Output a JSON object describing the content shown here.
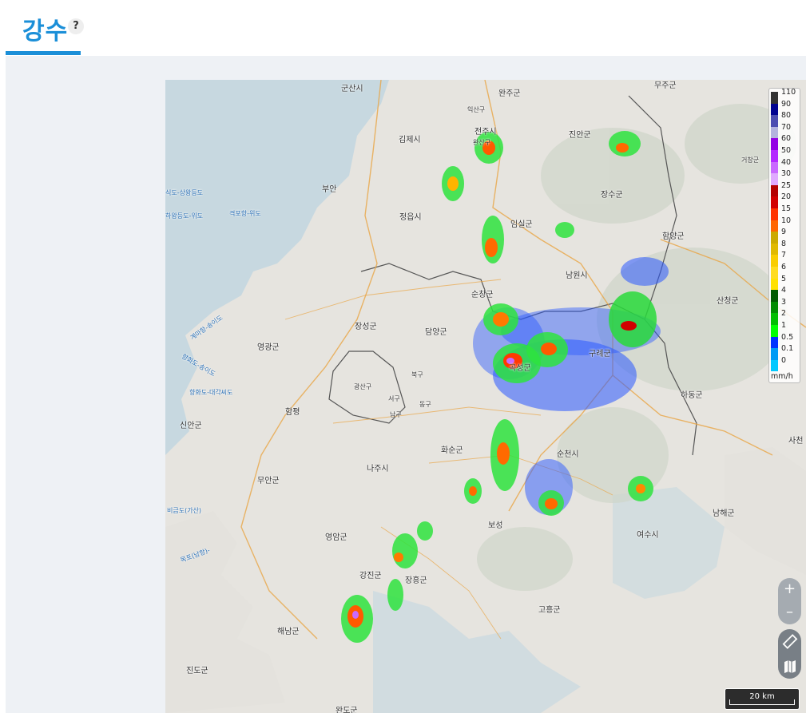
{
  "tab": {
    "title": "강수",
    "help": "?"
  },
  "legend": {
    "unit": "mm/h",
    "levels": [
      {
        "label": "110",
        "color": "#333333"
      },
      {
        "label": "90",
        "color": "#000390"
      },
      {
        "label": "80",
        "color": "#4c4eb1"
      },
      {
        "label": "70",
        "color": "#b3b4de"
      },
      {
        "label": "60",
        "color": "#9300e4"
      },
      {
        "label": "50",
        "color": "#b329ff"
      },
      {
        "label": "40",
        "color": "#c969ff"
      },
      {
        "label": "30",
        "color": "#e0a9ff"
      },
      {
        "label": "25",
        "color": "#b40000"
      },
      {
        "label": "20",
        "color": "#d20000"
      },
      {
        "label": "15",
        "color": "#ff3300"
      },
      {
        "label": "10",
        "color": "#ff6600"
      },
      {
        "label": "9",
        "color": "#ccaa00"
      },
      {
        "label": "8",
        "color": "#e0b900"
      },
      {
        "label": "7",
        "color": "#f9cd00"
      },
      {
        "label": "6",
        "color": "#ffdc1f"
      },
      {
        "label": "5",
        "color": "#ffe100"
      },
      {
        "label": "4",
        "color": "#005a00"
      },
      {
        "label": "3",
        "color": "#008c00"
      },
      {
        "label": "2",
        "color": "#00be00"
      },
      {
        "label": "1",
        "color": "#00ff00"
      },
      {
        "label": "0.5",
        "color": "#0033ff"
      },
      {
        "label": "0.1",
        "color": "#009bf5"
      },
      {
        "label": "0",
        "color": "#00c8ff"
      }
    ]
  },
  "places": [
    {
      "name": "군산시"
    },
    {
      "name": "완주군"
    },
    {
      "name": "무주군"
    },
    {
      "name": "익산구"
    },
    {
      "name": "전주시"
    },
    {
      "name": "완산구"
    },
    {
      "name": "김제시"
    },
    {
      "name": "진안군"
    },
    {
      "name": "부안"
    },
    {
      "name": "장수군"
    },
    {
      "name": "정읍시"
    },
    {
      "name": "임실군"
    },
    {
      "name": "함양군"
    },
    {
      "name": "남원시"
    },
    {
      "name": "순창군"
    },
    {
      "name": "산청군"
    },
    {
      "name": "장성군"
    },
    {
      "name": "담양군"
    },
    {
      "name": "영광군"
    },
    {
      "name": "곡성군"
    },
    {
      "name": "구례군"
    },
    {
      "name": "북구"
    },
    {
      "name": "광산구"
    },
    {
      "name": "서구"
    },
    {
      "name": "동구"
    },
    {
      "name": "남구"
    },
    {
      "name": "하동군"
    },
    {
      "name": "함평"
    },
    {
      "name": "화순군"
    },
    {
      "name": "순천시"
    },
    {
      "name": "사천"
    },
    {
      "name": "나주시"
    },
    {
      "name": "무안군"
    },
    {
      "name": "남해군"
    },
    {
      "name": "보성"
    },
    {
      "name": "여수시"
    },
    {
      "name": "영암군"
    },
    {
      "name": "강진군"
    },
    {
      "name": "장흥군"
    },
    {
      "name": "고흥군"
    },
    {
      "name": "해남군"
    },
    {
      "name": "진도군"
    },
    {
      "name": "완도군"
    },
    {
      "name": "신안군"
    },
    {
      "name": "거창군"
    }
  ],
  "sea_labels": [
    {
      "name": "식도-상왕등도"
    },
    {
      "name": "하왕등도-위도"
    },
    {
      "name": "격포항-위도"
    },
    {
      "name": "계마항-송이도"
    },
    {
      "name": "향화도-송이도"
    },
    {
      "name": "향화도-대각씨도"
    },
    {
      "name": "비금도(가산)"
    },
    {
      "name": "목포(남항)-"
    }
  ],
  "controls": {
    "zoom_in": "+",
    "zoom_out": "–"
  },
  "scale": {
    "label": "20 km"
  }
}
